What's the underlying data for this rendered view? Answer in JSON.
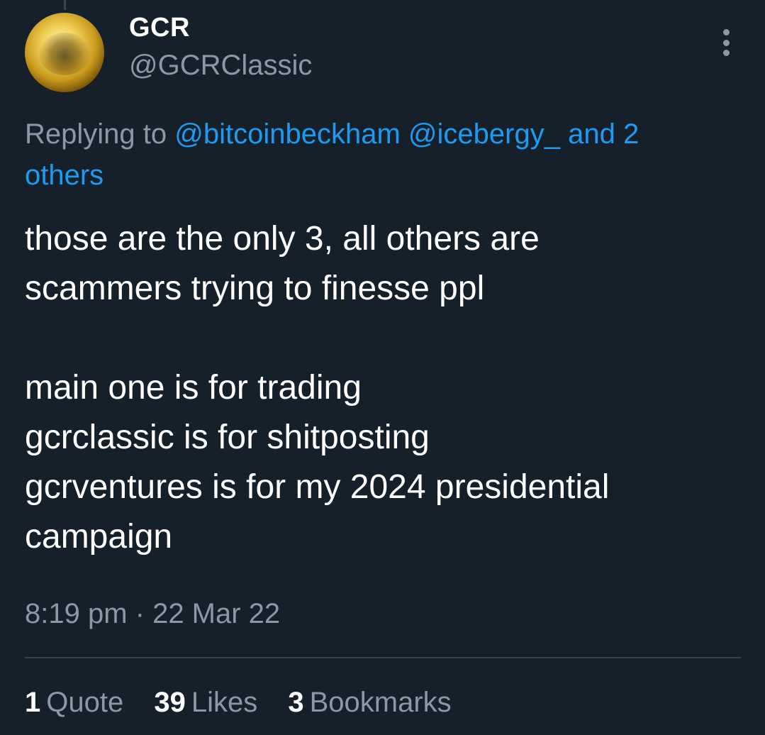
{
  "author": {
    "name": "GCR",
    "handle": "@GCRClassic",
    "avatar_icon": "gold-coin-avatar"
  },
  "menu": {
    "icon": "more-vertical-icon"
  },
  "reply": {
    "prefix": "Replying to",
    "mention_1": "@bitcoinbeckham",
    "mention_2": "@icebergy_",
    "suffix_and": "and 2",
    "suffix_others": "others"
  },
  "tweet": {
    "lines": [
      "those are the only 3, all others are",
      "scammers trying to finesse ppl",
      "",
      "main one is for trading",
      "gcrclassic is for shitposting",
      "gcrventures is for my 2024 presidential",
      "campaign"
    ]
  },
  "meta": {
    "timestamp": "8:19 pm · 22 Mar 22"
  },
  "stats": {
    "quotes_count": "1",
    "quotes_label": "Quote",
    "likes_count": "39",
    "likes_label": "Likes",
    "bookmarks_count": "3",
    "bookmarks_label": "Bookmarks"
  },
  "colors": {
    "background": "#15202b",
    "accent": "#1d9bf0",
    "secondary_text": "#8b98a5",
    "divider": "#38444d"
  }
}
